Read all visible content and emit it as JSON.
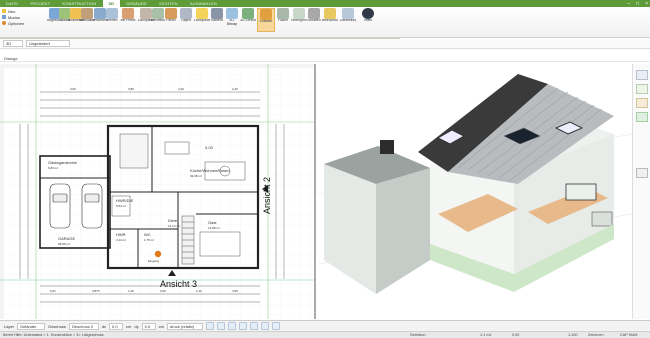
{
  "ribbon_tabs": [
    "DATEI",
    "PROJEKT",
    "KONSTRUKTION",
    "3D",
    "GEBÄUDE",
    "SICHTEN",
    "AUSWAHLEN"
  ],
  "active_tab": "3D",
  "quick_access": {
    "neu": "Neu",
    "modus": "Modus",
    "optionen": "Optionen"
  },
  "ribbon_buttons": [
    {
      "label": "Abgeschnitt",
      "icon": "clip-icon"
    },
    {
      "label": "Zusatz",
      "icon": "add-icon"
    },
    {
      "label": "Bearbeiten",
      "icon": "edit-icon"
    },
    {
      "label": "Stabbalken",
      "icon": "beam-icon"
    },
    {
      "label": "Verschieben",
      "icon": "move-icon"
    },
    {
      "label": "Drehen",
      "icon": "rotate-icon"
    },
    {
      "label": "Mit Pinsel",
      "icon": "brush-icon"
    },
    {
      "label": "Dachplatten",
      "icon": "roof-tiles-icon"
    },
    {
      "label": "Rechteck",
      "icon": "rect-icon"
    },
    {
      "label": "Pinsel",
      "icon": "paint-icon"
    },
    {
      "label": "Objekt",
      "icon": "object-icon"
    },
    {
      "label": "Lichtquelle",
      "icon": "light-icon"
    },
    {
      "label": "Kamera",
      "icon": "camera-icon"
    },
    {
      "label": "3D-Bitmap",
      "icon": "bitmap-icon"
    },
    {
      "label": "3D-Schnitt",
      "icon": "section-icon"
    },
    {
      "label": "Kollision",
      "icon": "collision-icon"
    },
    {
      "label": "Fläche",
      "icon": "area-icon"
    },
    {
      "label": "Hintergrund",
      "icon": "background-icon"
    },
    {
      "label": "Schatten",
      "icon": "shadow-icon"
    },
    {
      "label": "Beleuchtung",
      "icon": "lighting-icon"
    },
    {
      "label": "Darstellung",
      "icon": "display-icon"
    },
    {
      "label": "Video",
      "icon": "video-icon"
    }
  ],
  "ribbon_groups": [
    "Auswahl",
    "Material",
    "Schriften",
    "Einfügen",
    "Sonstige",
    "Info",
    "Einstellungen"
  ],
  "selectors": {
    "view": "3D",
    "layer": "Ungeändert"
  },
  "doc_tab": "Dialoge",
  "plan": {
    "rooms": [
      {
        "name": "Gästegarderobe",
        "area": "6,83 m²"
      },
      {
        "name": "GARAGE",
        "area": "38,85 m²"
      },
      {
        "name": "HWR/DIE",
        "area": "8,54 m²"
      },
      {
        "name": "HWR",
        "area": "3,14 m²"
      },
      {
        "name": "WC",
        "area": "1,75 m²"
      },
      {
        "name": "Diele",
        "area": "12,14 m²"
      },
      {
        "name": "Gast",
        "area": "13,88 m²"
      },
      {
        "name": "Küche/Wohnen/Essen",
        "area": "49,68 m²"
      },
      {
        "name": "Eingang",
        "area": ""
      }
    ],
    "room_number": "0,03",
    "view_labels": {
      "right": "Ansicht 2",
      "bottom": "Ansicht 3"
    },
    "dims_top": [
      "4,60",
      "3,89",
      "4,40",
      "2,40"
    ],
    "dims_bottom": [
      "6,01",
      "3,875",
      "1,49",
      "3,00",
      "2,16",
      "4,55"
    ]
  },
  "bottom": {
    "layer_label": "Layer",
    "layer_value": "Geländer",
    "geschoss_label": "Geschoss",
    "geschoss_value": "Geschoss 0",
    "dx_label": "dx",
    "dx_value": "0,0",
    "dx_unit": "cm",
    "dy_label": "dy",
    "dy_value": "0,0",
    "dy_unit": "cm",
    "mode": "druck (relativ)"
  },
  "status": {
    "left": "Bereit  Hilfe: Unterstand > 1. Konstruktion > 3> Listgeschoss",
    "sel": "Selektion",
    "scale": "1:1 m1",
    "x": "0,00",
    "zoom": "1:100",
    "mode": "Zeichnen",
    "caps": "CAP NUM"
  }
}
